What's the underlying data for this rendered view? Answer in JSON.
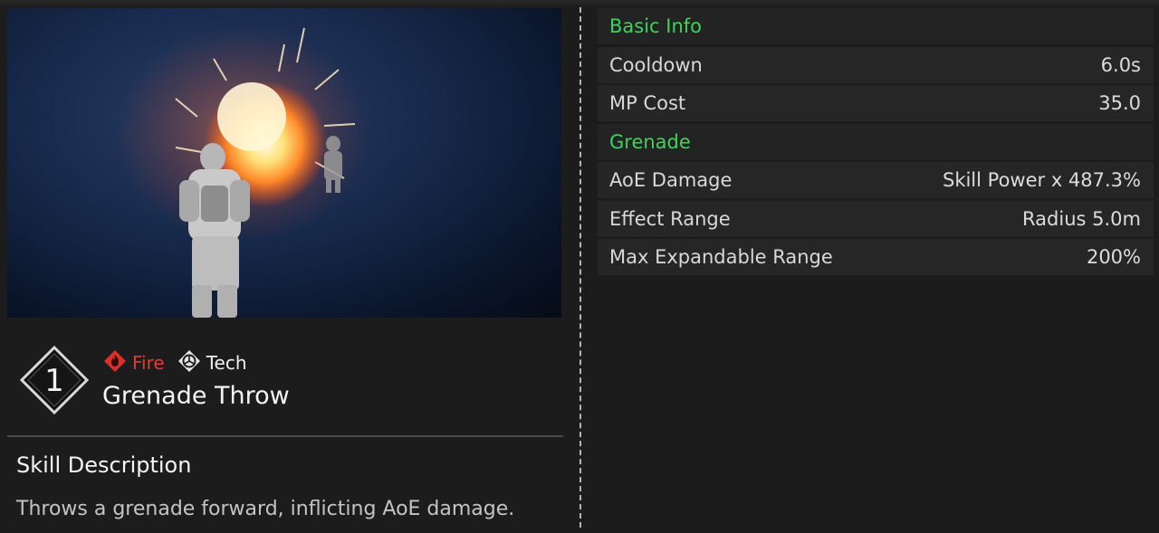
{
  "skill": {
    "slot_number": "1",
    "tags": [
      {
        "label": "Fire",
        "icon": "fire-attribute-icon",
        "color": "#e23a32"
      },
      {
        "label": "Tech",
        "icon": "tech-attribute-icon",
        "color": "#f0f0f0"
      }
    ],
    "name": "Grenade Throw"
  },
  "description": {
    "title": "Skill Description",
    "text": "Throws a grenade forward, inflicting AoE damage."
  },
  "stats": {
    "sections": [
      {
        "title": "Basic Info",
        "rows": [
          {
            "label": "Cooldown",
            "value": "6.0s"
          },
          {
            "label": "MP Cost",
            "value": "35.0"
          }
        ]
      },
      {
        "title": "Grenade",
        "rows": [
          {
            "label": "AoE Damage",
            "value": "Skill Power x 487.3%"
          },
          {
            "label": "Effect Range",
            "value": "Radius 5.0m"
          },
          {
            "label": "Max Expandable Range",
            "value": "200%"
          }
        ]
      }
    ]
  },
  "colors": {
    "section_header": "#3fd25c",
    "fire": "#e23a32",
    "background": "#1c1c1c",
    "row": "#262626"
  }
}
